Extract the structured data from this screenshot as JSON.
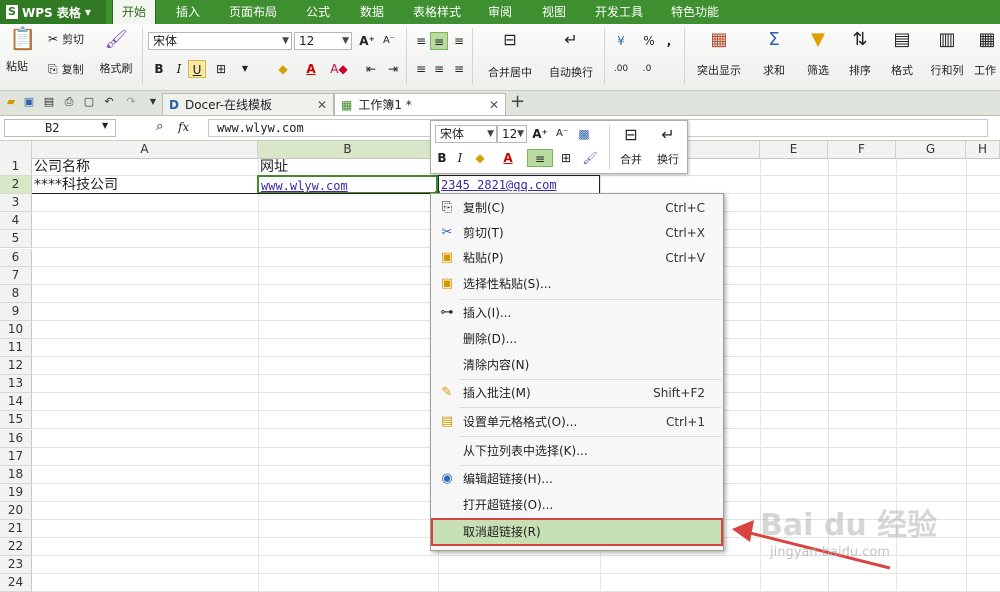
{
  "app": {
    "name": "WPS 表格"
  },
  "menu_tabs": [
    "开始",
    "插入",
    "页面布局",
    "公式",
    "数据",
    "表格样式",
    "审阅",
    "视图",
    "开发工具",
    "特色功能"
  ],
  "ribbon": {
    "paste": "粘贴",
    "cut": "剪切",
    "copy": "复制",
    "format_painter": "格式刷",
    "font_name": "宋体",
    "font_size": "12",
    "merge_center": "合并居中",
    "auto_wrap": "自动换行",
    "percent": "%",
    "highlight": "突出显示",
    "sum": "求和",
    "filter": "筛选",
    "sort": "排序",
    "format": "格式",
    "rows_cols": "行和列",
    "work": "工作"
  },
  "doc_tabs": [
    {
      "label": "Docer-在线模板"
    },
    {
      "label": "工作簿1 *"
    }
  ],
  "formula_bar": {
    "cell_ref": "B2",
    "fx": "fx",
    "value": "www.wlyw.com"
  },
  "grid": {
    "columns": [
      "A",
      "B",
      "C",
      "D",
      "E",
      "F",
      "G",
      "H"
    ],
    "rows": [
      "1",
      "2",
      "3",
      "4",
      "5",
      "6",
      "7",
      "8",
      "9",
      "10",
      "11",
      "12",
      "13",
      "14",
      "15",
      "16",
      "17",
      "18",
      "19",
      "20",
      "21",
      "22",
      "23",
      "24"
    ],
    "cells": {
      "A1": "公司名称",
      "B1": "网址",
      "C1": "网址",
      "A2": "****科技公司",
      "B2": "www.wlyw.com",
      "C2": "2345  2821@qq.com"
    }
  },
  "mini_toolbar": {
    "font_name": "宋体",
    "font_size": "12",
    "merge": "合并",
    "wrap": "换行"
  },
  "context_menu": [
    {
      "label": "复制(C)",
      "shortcut": "Ctrl+C"
    },
    {
      "label": "剪切(T)",
      "shortcut": "Ctrl+X"
    },
    {
      "label": "粘贴(P)",
      "shortcut": "Ctrl+V"
    },
    {
      "label": "选择性粘贴(S)...",
      "shortcut": ""
    },
    {
      "label": "插入(I)...",
      "shortcut": ""
    },
    {
      "label": "删除(D)...",
      "shortcut": ""
    },
    {
      "label": "清除内容(N)",
      "shortcut": ""
    },
    {
      "label": "插入批注(M)",
      "shortcut": "Shift+F2"
    },
    {
      "label": "设置单元格格式(O)...",
      "shortcut": "Ctrl+1"
    },
    {
      "label": "从下拉列表中选择(K)...",
      "shortcut": ""
    },
    {
      "label": "编辑超链接(H)...",
      "shortcut": ""
    },
    {
      "label": "打开超链接(O)...",
      "shortcut": ""
    },
    {
      "label": "取消超链接(R)",
      "shortcut": ""
    }
  ],
  "watermark": {
    "brand": "Bai du 经验",
    "url": "jingyan.baidu.com"
  },
  "colors": {
    "menubar": "#3e8f2f",
    "highlight_row": "#c6e0b4",
    "highlight_border": "#d8433f",
    "arrow": "#d8433f"
  }
}
